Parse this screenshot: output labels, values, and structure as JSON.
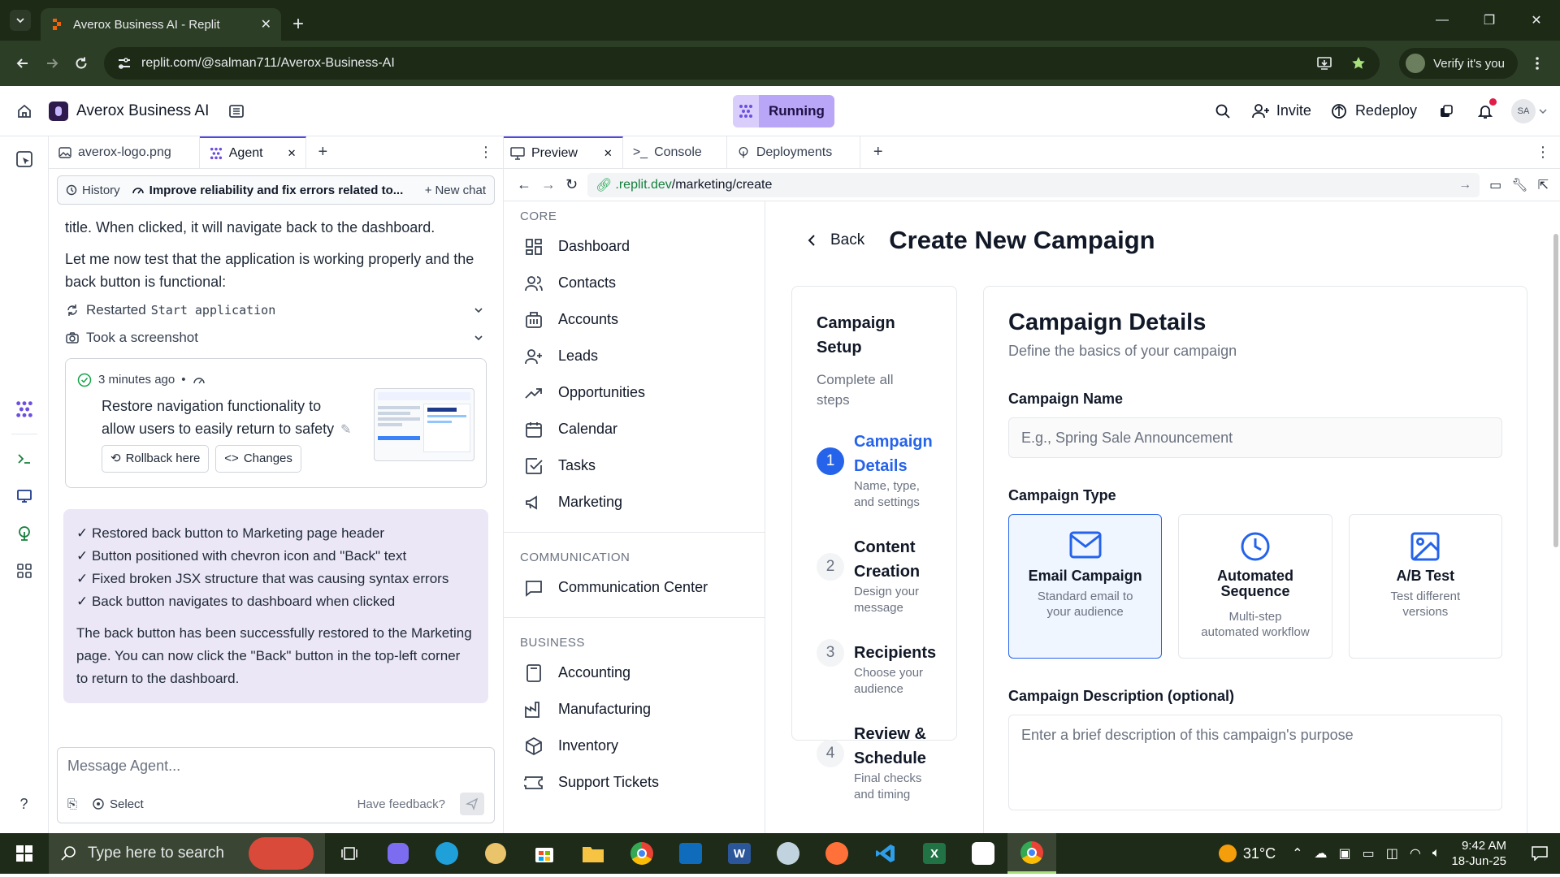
{
  "browser": {
    "tab_title": "Averox Business AI - Replit",
    "url": "replit.com/@salman711/Averox-Business-AI",
    "verify_label": "Verify it's you"
  },
  "replit": {
    "project_name": "Averox Business AI",
    "run_status": "Running",
    "invite_label": "Invite",
    "redeploy_label": "Redeploy",
    "avatar_initials": "SA"
  },
  "left_tabs": [
    "averox-logo.png",
    "Agent"
  ],
  "chat_toolbar": {
    "history": "History",
    "title": "Improve reliability and fix errors related to...",
    "new_chat": "New chat"
  },
  "chat": {
    "para1": "title. When clicked, it will navigate back to the dashboard.",
    "para2": "Let me now test that the application is working properly and the back button is functional:",
    "action1_verb": "Restarted",
    "action1_code": "Start application",
    "action2": "Took a screenshot",
    "checkpoint_time": "3 minutes ago",
    "checkpoint_text": "Restore navigation functionality to allow users to easily return to safety",
    "rollback_label": "Rollback here",
    "changes_label": "Changes",
    "summary_items": [
      "✓ Restored back button to Marketing page header",
      "✓ Button positioned with chevron icon and \"Back\" text",
      "✓ Fixed broken JSX structure that was causing syntax errors",
      "✓ Back button navigates to dashboard when clicked"
    ],
    "summary_text": "The back button has been successfully restored to the Marketing page. You can now click the \"Back\" button in the top-left corner to return to the dashboard.",
    "composer_placeholder": "Message Agent...",
    "select_label": "Select",
    "feedback_label": "Have feedback?"
  },
  "right_tabs": [
    "Preview",
    "Console",
    "Deployments"
  ],
  "webview": {
    "url_host": ".replit.dev",
    "url_path": "/marketing/create"
  },
  "app_nav": {
    "core_label": "CORE",
    "core": [
      "Dashboard",
      "Contacts",
      "Accounts",
      "Leads",
      "Opportunities",
      "Calendar",
      "Tasks",
      "Marketing"
    ],
    "comm_label": "COMMUNICATION",
    "comm": [
      "Communication Center"
    ],
    "biz_label": "BUSINESS",
    "biz": [
      "Accounting",
      "Manufacturing",
      "Inventory",
      "Support Tickets"
    ]
  },
  "page": {
    "back_label": "Back",
    "title": "Create New Campaign",
    "setup_title": "Campaign Setup",
    "setup_sub": "Complete all steps",
    "steps": [
      {
        "num": "1",
        "title": "Campaign Details",
        "desc": "Name, type, and settings"
      },
      {
        "num": "2",
        "title": "Content Creation",
        "desc": "Design your message"
      },
      {
        "num": "3",
        "title": "Recipients",
        "desc": "Choose your audience"
      },
      {
        "num": "4",
        "title": "Review & Schedule",
        "desc": "Final checks and timing"
      }
    ],
    "details_title": "Campaign Details",
    "details_sub": "Define the basics of your campaign",
    "name_label": "Campaign Name",
    "name_placeholder": "E.g., Spring Sale Announcement",
    "type_label": "Campaign Type",
    "types": [
      {
        "title": "Email Campaign",
        "desc": "Standard email to your audience"
      },
      {
        "title": "Automated Sequence",
        "desc": "Multi-step automated workflow"
      },
      {
        "title": "A/B Test",
        "desc": "Test different versions"
      }
    ],
    "desc_label": "Campaign Description (optional)",
    "desc_placeholder": "Enter a brief description of this campaign's purpose"
  },
  "taskbar": {
    "search_placeholder": "Type here to search",
    "temperature": "31°C",
    "time": "9:42 AM",
    "date": "18-Jun-25"
  },
  "colors": {
    "accent": "#2563eb",
    "running_bg": "#b9a6f7",
    "chrome_bg": "#1c2a16"
  }
}
